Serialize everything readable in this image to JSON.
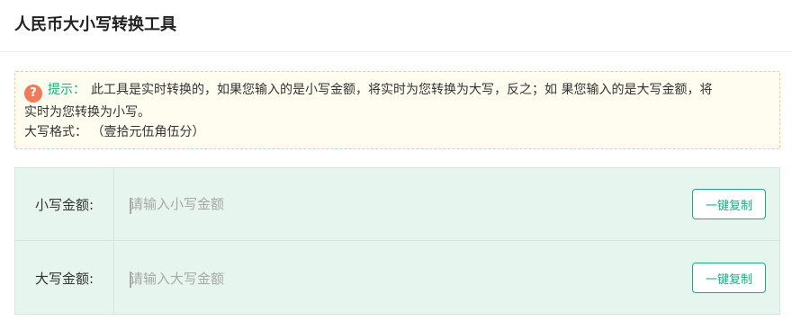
{
  "header": {
    "title": "人民币大小写转换工具"
  },
  "tip": {
    "icon": "question-icon",
    "icon_glyph": "?",
    "label": "提示：",
    "text_line1": "此工具是实时转换的，如果您输入的是小写金额，将实时为您转换为大写，反之；如 果您输入的是大写金额，将",
    "text_line2": "实时为您转换为小写。",
    "format_label": "大写格式：",
    "format_value": "（壹拾元伍角伍分）"
  },
  "converter": {
    "lowercase": {
      "label": "小写金额:",
      "value": "",
      "placeholder": "请输入小写金额",
      "copy_label": "一键复制"
    },
    "uppercase": {
      "label": "大写金额:",
      "value": "",
      "placeholder": "请输入大写金额",
      "copy_label": "一键复制"
    }
  },
  "colors": {
    "accent": "#1aad7f",
    "tip_background": "#fffdf0",
    "tip_border": "#f3cf86",
    "tip_icon": "#f07b5b",
    "converter_background": "#e6f5ee"
  }
}
